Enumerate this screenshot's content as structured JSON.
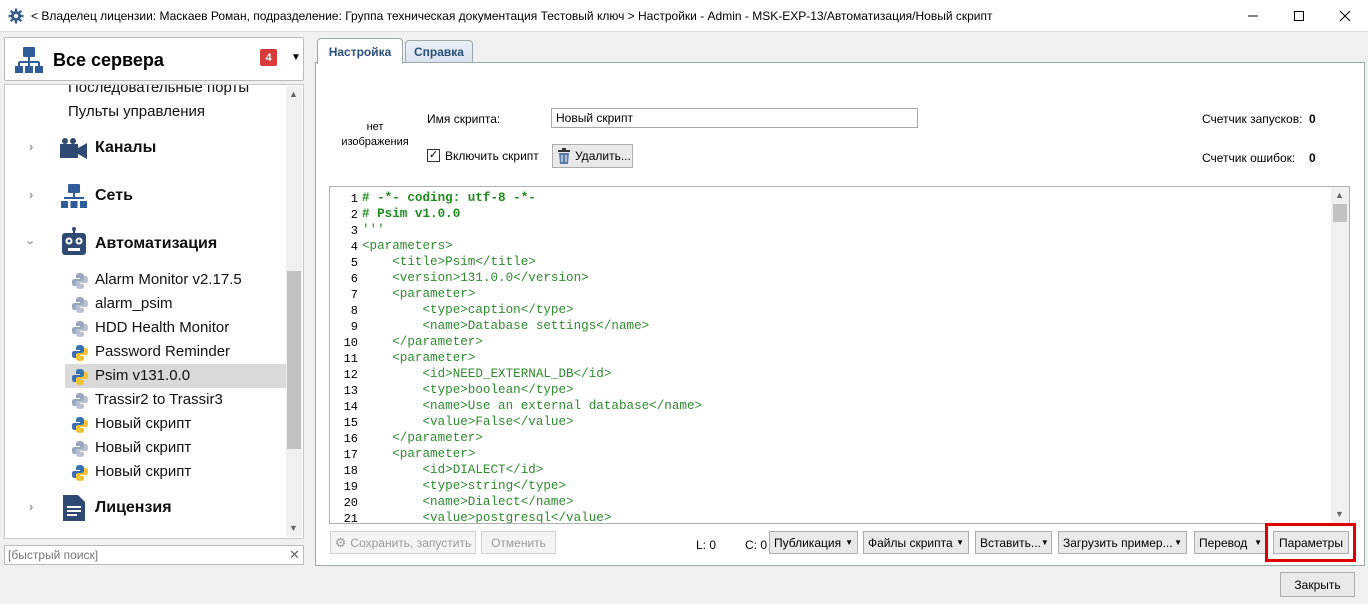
{
  "window": {
    "title": "< Владелец лицензии: Маскаев Роман, подразделение: Группа техническая документация Тестовый ключ > Настройки - Admin - MSK-EXP-13/Автоматизация/Новый скрипт"
  },
  "sidebar": {
    "server_selector": {
      "label": "Все сервера",
      "badge": "4"
    },
    "items": [
      {
        "label": "Последовательные порты"
      },
      {
        "label": "Пульты управления"
      },
      {
        "label": "Каналы"
      },
      {
        "label": "Сеть"
      },
      {
        "label": "Автоматизация"
      },
      {
        "label": "Alarm Monitor v2.17.5"
      },
      {
        "label": "alarm_psim"
      },
      {
        "label": "HDD Health Monitor"
      },
      {
        "label": "Password Reminder"
      },
      {
        "label": "Psim v131.0.0"
      },
      {
        "label": "Trassir2 to Trassir3"
      },
      {
        "label": "Новый скрипт"
      },
      {
        "label": "Новый скрипт"
      },
      {
        "label": "Новый скрипт"
      },
      {
        "label": "Лицензия"
      }
    ],
    "search_placeholder": "[быстрый поиск]"
  },
  "tabs": [
    {
      "label": "Настройка",
      "active": true
    },
    {
      "label": "Справка",
      "active": false
    }
  ],
  "script": {
    "no_image": "нет изображения",
    "name_label": "Имя скрипта:",
    "name_value": "Новый скрипт",
    "enable_label": "Включить скрипт",
    "enabled": true,
    "delete_label": "Удалить...",
    "run_counter_label": "Счетчик запусков:",
    "run_counter": "0",
    "error_counter_label": "Счетчик ошибок:",
    "error_counter": "0"
  },
  "editor": {
    "lines": [
      "# -*- coding: utf-8 -*-",
      "# Psim v1.0.0",
      "'''",
      "<parameters>",
      "    <title>Psim</title>",
      "    <version>131.0.0</version>",
      "    <parameter>",
      "        <type>caption</type>",
      "        <name>Database settings</name>",
      "    </parameter>",
      "    <parameter>",
      "        <id>NEED_EXTERNAL_DB</id>",
      "        <type>boolean</type>",
      "        <name>Use an external database</name>",
      "        <value>False</value>",
      "    </parameter>",
      "    <parameter>",
      "        <id>DIALECT</id>",
      "        <type>string</type>",
      "        <name>Dialect</name>",
      "        <value>postgresql</value>"
    ]
  },
  "toolbar": {
    "save_run": "Сохранить, запустить",
    "cancel": "Отменить",
    "line_indicator": "L: 0",
    "col_indicator": "C: 0",
    "publish": "Публикация",
    "script_files": "Файлы скрипта",
    "insert": "Вставить...",
    "load_example": "Загрузить пример...",
    "translate": "Перевод",
    "parameters": "Параметры",
    "highlight_color": "#e00000"
  },
  "footer": {
    "close": "Закрыть"
  }
}
